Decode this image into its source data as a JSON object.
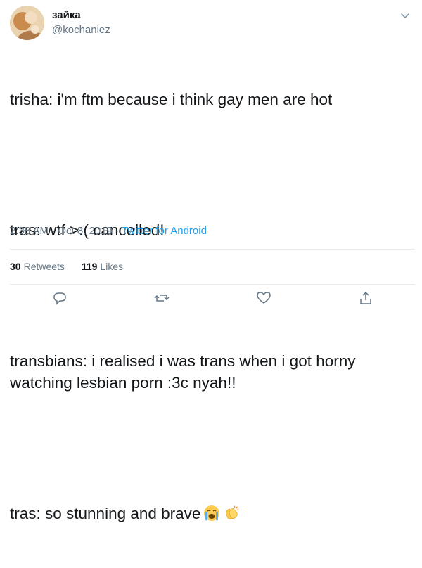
{
  "user": {
    "display_name": "зайка",
    "handle": "@kochaniez"
  },
  "tweet": {
    "lines": [
      "trisha: i'm ftm because i think gay men are hot",
      "tras: wtf >:( cancelled!",
      "transbians: i realised i was trans when i got horny watching lesbian porn :3c nyah!!",
      "tras: so stunning and brave"
    ],
    "emojis": [
      "crying-face-emoji",
      "clapping-hands-emoji"
    ],
    "time": "2:38 AM",
    "date": "Oct 8, 2019",
    "separator": "·",
    "source": "Twitter for Android"
  },
  "stats": {
    "retweets_count": "30",
    "retweets_label": "Retweets",
    "likes_count": "119",
    "likes_label": "Likes"
  },
  "colors": {
    "link": "#1da1f2",
    "secondary_text": "#657786",
    "divider": "#e6ecf0"
  },
  "icons": [
    "chevron-down-icon",
    "reply-icon",
    "retweet-icon",
    "like-icon",
    "share-icon"
  ]
}
